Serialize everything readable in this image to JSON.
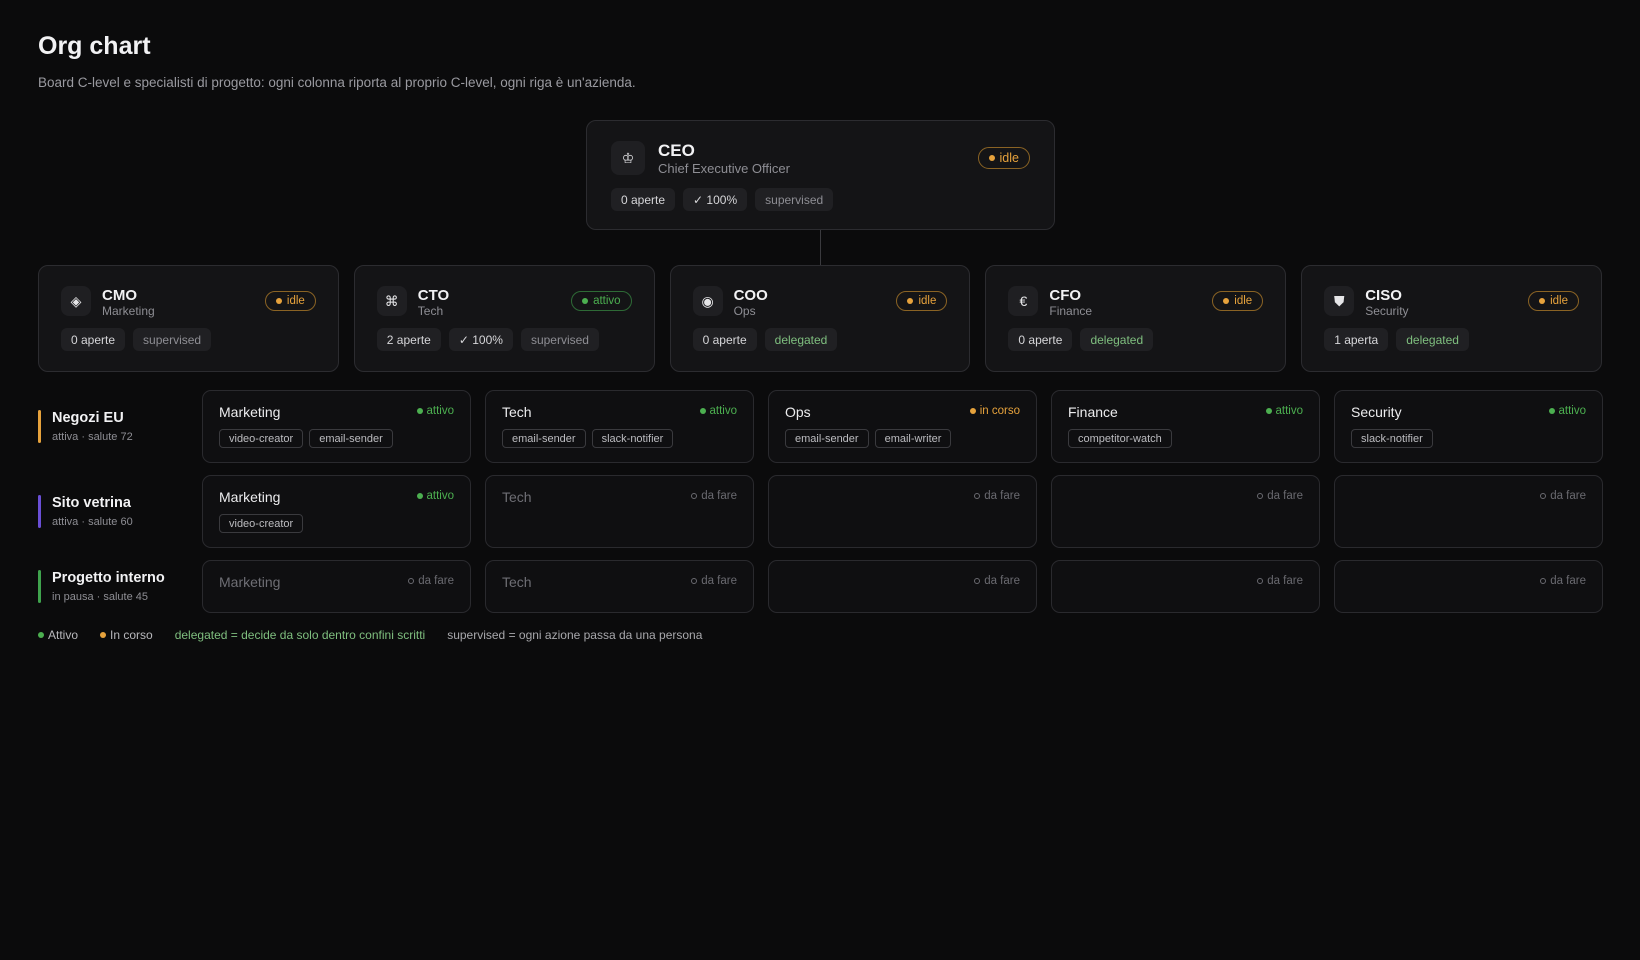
{
  "header": {
    "title": "Org chart",
    "subtitle": "Board C-level e specialisti di progetto: ogni colonna riporta al proprio C-level, ogni riga è un'azienda."
  },
  "colors": {
    "background": "#0b0b0c",
    "idle": "#e6a23c",
    "attivo": "#4caf50",
    "delegated": "#7fbf7f"
  },
  "ceo": {
    "icon": "crown-icon",
    "glyph": "♔",
    "name": "CEO",
    "subtitle": "Chief Executive Officer",
    "status": "idle",
    "chips": [
      "0 aperte",
      "✓ 100%",
      "supervised"
    ]
  },
  "clevel": [
    {
      "icon": "diamond-icon",
      "glyph": "◈",
      "name": "CMO",
      "subtitle": "Marketing",
      "status": "idle",
      "status_label": "idle",
      "chips": [
        "0 aperte",
        "supervised"
      ]
    },
    {
      "icon": "command-icon",
      "glyph": "⌘",
      "name": "CTO",
      "subtitle": "Tech",
      "status": "attivo",
      "status_label": "attivo",
      "chips": [
        "2 aperte",
        "✓ 100%",
        "supervised"
      ]
    },
    {
      "icon": "target-icon",
      "glyph": "◉",
      "name": "COO",
      "subtitle": "Ops",
      "status": "idle",
      "status_label": "idle",
      "chips": [
        "0 aperte",
        "delegated"
      ]
    },
    {
      "icon": "euro-icon",
      "glyph": "€",
      "name": "CFO",
      "subtitle": "Finance",
      "status": "idle",
      "status_label": "idle",
      "chips": [
        "0 aperte",
        "delegated"
      ]
    },
    {
      "icon": "shield-icon",
      "glyph": "⛊",
      "name": "CISO",
      "subtitle": "Security",
      "status": "idle",
      "status_label": "idle",
      "chips": [
        "1 aperta",
        "delegated"
      ]
    }
  ],
  "companies": [
    {
      "name": "Negozi EU",
      "meta": "attiva · salute 72",
      "bar_color": "#e6a23c",
      "cells": [
        {
          "title": "Marketing",
          "status": "attivo",
          "status_label": "attivo",
          "tags": [
            "video-creator",
            "email-sender"
          ]
        },
        {
          "title": "Tech",
          "status": "attivo",
          "status_label": "attivo",
          "tags": [
            "email-sender",
            "slack-notifier"
          ]
        },
        {
          "title": "Ops",
          "status": "incorso",
          "status_label": "in corso",
          "tags": [
            "email-sender",
            "email-writer"
          ]
        },
        {
          "title": "Finance",
          "status": "attivo",
          "status_label": "attivo",
          "tags": [
            "competitor-watch"
          ]
        },
        {
          "title": "Security",
          "status": "attivo",
          "status_label": "attivo",
          "tags": [
            "slack-notifier"
          ]
        }
      ]
    },
    {
      "name": "Sito vetrina",
      "meta": "attiva · salute 60",
      "bar_color": "#6a4fd6",
      "cells": [
        {
          "title": "Marketing",
          "status": "attivo",
          "status_label": "attivo",
          "tags": [
            "video-creator"
          ]
        },
        {
          "title": "Tech",
          "status": "dafare",
          "status_label": "da fare",
          "tags": []
        },
        {
          "title": "",
          "status": "dafare",
          "status_label": "da fare",
          "tags": []
        },
        {
          "title": "",
          "status": "dafare",
          "status_label": "da fare",
          "tags": []
        },
        {
          "title": "",
          "status": "dafare",
          "status_label": "da fare",
          "tags": []
        }
      ]
    },
    {
      "name": "Progetto interno",
      "meta": "in pausa · salute 45",
      "bar_color": "#3fa34d",
      "cells": [
        {
          "title": "Marketing",
          "status": "dafare",
          "status_label": "da fare",
          "tags": []
        },
        {
          "title": "Tech",
          "status": "dafare",
          "status_label": "da fare",
          "tags": []
        },
        {
          "title": "",
          "status": "dafare",
          "status_label": "da fare",
          "tags": []
        },
        {
          "title": "",
          "status": "dafare",
          "status_label": "da fare",
          "tags": []
        },
        {
          "title": "",
          "status": "dafare",
          "status_label": "da fare",
          "tags": []
        }
      ]
    }
  ],
  "legend": {
    "attivo": "Attivo",
    "incorso": "In corso",
    "delegated": "delegated = decide da solo dentro confini scritti",
    "supervised": "supervised = ogni azione passa da una persona"
  }
}
